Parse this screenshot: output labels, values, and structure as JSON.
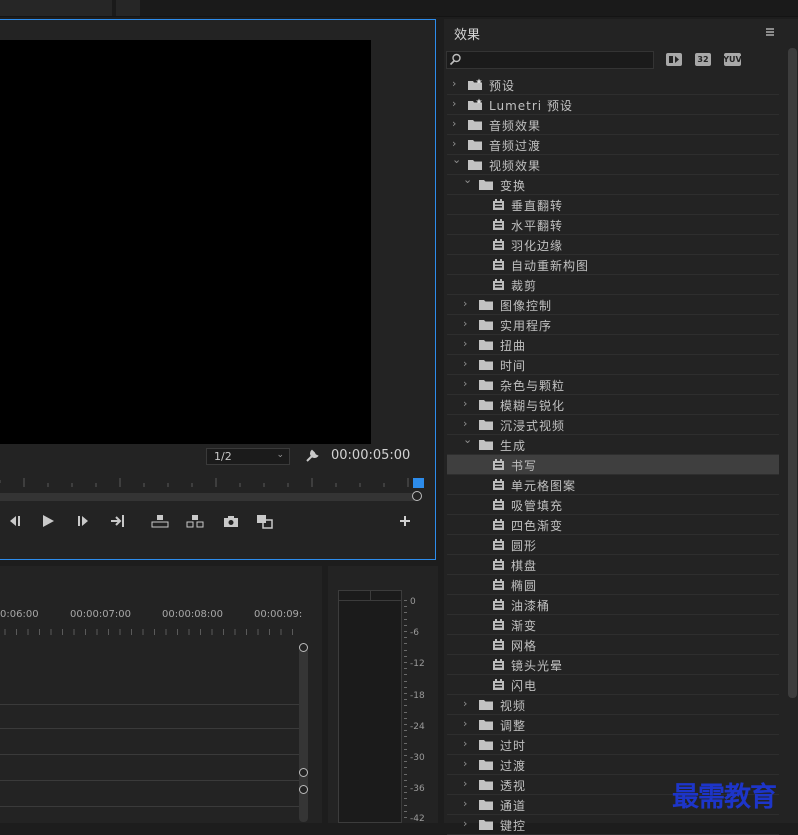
{
  "program": {
    "resolution": "1/2",
    "timecode": "00:00:05:00",
    "icons": [
      "wrench-icon",
      "step-back-icon",
      "play-icon",
      "step-forward-icon",
      "go-to-out-icon",
      "lift-icon",
      "extract-icon",
      "camera-icon",
      "compare-icon",
      "add-icon"
    ]
  },
  "timeline": {
    "times": [
      "0:06:00",
      "00:00:07:00",
      "00:00:08:00",
      "00:00:09:"
    ]
  },
  "meter": {
    "labels": [
      "0",
      "-6",
      "-12",
      "-18",
      "-24",
      "-30",
      "-36",
      "-42"
    ]
  },
  "effects": {
    "title": "效果",
    "search_value": "",
    "badges": [
      "accelerated-effects-icon",
      "32-bit-icon",
      "yuv-icon"
    ],
    "badge_text": [
      "32",
      "YUV"
    ],
    "items": [
      {
        "label": "预设",
        "level": 0,
        "type": "star-folder",
        "expanded": false
      },
      {
        "label": "Lumetri 预设",
        "level": 0,
        "type": "star-folder",
        "expanded": false
      },
      {
        "label": "音频效果",
        "level": 0,
        "type": "folder",
        "expanded": false
      },
      {
        "label": "音频过渡",
        "level": 0,
        "type": "folder",
        "expanded": false
      },
      {
        "label": "视频效果",
        "level": 0,
        "type": "folder",
        "expanded": true
      },
      {
        "label": "变换",
        "level": 1,
        "type": "folder",
        "expanded": true
      },
      {
        "label": "垂直翻转",
        "level": 2,
        "type": "effect"
      },
      {
        "label": "水平翻转",
        "level": 2,
        "type": "effect"
      },
      {
        "label": "羽化边缘",
        "level": 2,
        "type": "effect"
      },
      {
        "label": "自动重新构图",
        "level": 2,
        "type": "effect"
      },
      {
        "label": "裁剪",
        "level": 2,
        "type": "effect"
      },
      {
        "label": "图像控制",
        "level": 1,
        "type": "folder",
        "expanded": false
      },
      {
        "label": "实用程序",
        "level": 1,
        "type": "folder",
        "expanded": false
      },
      {
        "label": "扭曲",
        "level": 1,
        "type": "folder",
        "expanded": false
      },
      {
        "label": "时间",
        "level": 1,
        "type": "folder",
        "expanded": false
      },
      {
        "label": "杂色与颗粒",
        "level": 1,
        "type": "folder",
        "expanded": false
      },
      {
        "label": "模糊与锐化",
        "level": 1,
        "type": "folder",
        "expanded": false
      },
      {
        "label": "沉浸式视频",
        "level": 1,
        "type": "folder",
        "expanded": false
      },
      {
        "label": "生成",
        "level": 1,
        "type": "folder",
        "expanded": true
      },
      {
        "label": "书写",
        "level": 2,
        "type": "effect",
        "selected": true
      },
      {
        "label": "单元格图案",
        "level": 2,
        "type": "effect"
      },
      {
        "label": "吸管填充",
        "level": 2,
        "type": "effect"
      },
      {
        "label": "四色渐变",
        "level": 2,
        "type": "effect"
      },
      {
        "label": "圆形",
        "level": 2,
        "type": "effect"
      },
      {
        "label": "棋盘",
        "level": 2,
        "type": "effect"
      },
      {
        "label": "椭圆",
        "level": 2,
        "type": "effect"
      },
      {
        "label": "油漆桶",
        "level": 2,
        "type": "effect"
      },
      {
        "label": "渐变",
        "level": 2,
        "type": "effect"
      },
      {
        "label": "网格",
        "level": 2,
        "type": "effect"
      },
      {
        "label": "镜头光晕",
        "level": 2,
        "type": "effect"
      },
      {
        "label": "闪电",
        "level": 2,
        "type": "effect"
      },
      {
        "label": "视频",
        "level": 1,
        "type": "folder",
        "expanded": false
      },
      {
        "label": "调整",
        "level": 1,
        "type": "folder",
        "expanded": false
      },
      {
        "label": "过时",
        "level": 1,
        "type": "folder",
        "expanded": false
      },
      {
        "label": "过渡",
        "level": 1,
        "type": "folder",
        "expanded": false
      },
      {
        "label": "透视",
        "level": 1,
        "type": "folder",
        "expanded": false
      },
      {
        "label": "通道",
        "level": 1,
        "type": "folder",
        "expanded": false
      },
      {
        "label": "键控",
        "level": 1,
        "type": "folder",
        "expanded": false
      }
    ]
  },
  "watermark": "最需教育",
  "colors": {
    "accent": "#2d8ceb",
    "panel": "#232323",
    "watermark": "#1d35c9"
  }
}
